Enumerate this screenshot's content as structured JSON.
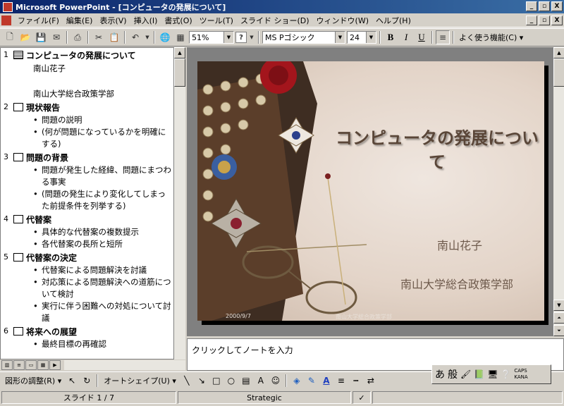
{
  "window": {
    "title": "Microsoft PowerPoint - [コンピュータの発展について]",
    "minimize": "_",
    "maximize": "▫",
    "close": "X"
  },
  "menu": [
    "ファイル(F)",
    "編集(E)",
    "表示(V)",
    "挿入(I)",
    "書式(O)",
    "ツール(T)",
    "スライド ショー(D)",
    "ウィンドウ(W)",
    "ヘルプ(H)"
  ],
  "toolbar": {
    "zoom": "51%",
    "font": "MS Pゴシック",
    "font_size": "24",
    "bold": "B",
    "italic": "I",
    "underline": "U",
    "common_tasks": "よく使う機能(C) ▾"
  },
  "outline": {
    "slides": [
      {
        "num": "1",
        "title": "コンピュータの発展について",
        "subs": [
          "南山花子",
          "",
          "南山大学総合政策学部"
        ],
        "bullets": []
      },
      {
        "num": "2",
        "title": "現状報告",
        "subs": [],
        "bullets": [
          "問題の説明",
          "(何が問題になっているかを明確にする)"
        ]
      },
      {
        "num": "3",
        "title": "問題の背景",
        "subs": [],
        "bullets": [
          "問題が発生した経緯、問題にまつわる事実",
          "(問題の発生により変化してしまった前提条件を列挙する)"
        ]
      },
      {
        "num": "4",
        "title": "代替案",
        "subs": [],
        "bullets": [
          "具体的な代替案の複数提示",
          "各代替案の長所と短所"
        ]
      },
      {
        "num": "5",
        "title": "代替案の決定",
        "subs": [],
        "bullets": [
          "代替案による問題解決を討議",
          "対応策による問題解決への道筋について検討",
          "実行に伴う困難への対処について討議"
        ]
      },
      {
        "num": "6",
        "title": "将来への展望",
        "subs": [],
        "bullets": [
          "最終目標の再確認"
        ]
      }
    ]
  },
  "slide": {
    "title": "コンピュータの発展について",
    "subtitle1": "南山花子",
    "subtitle2": "南山大学総合政策学部",
    "date": "2000/9/7",
    "footer": "南山大学総合政策学部"
  },
  "notes": {
    "placeholder": "クリックしてノートを入力"
  },
  "drawing": {
    "draw_menu": "図形の調整(R) ▾",
    "autoshapes": "オートシェイプ(U) ▾"
  },
  "ime": {
    "mode": "あ",
    "dictionary": "般",
    "caps": "CAPS",
    "kana": "KANA"
  },
  "status": {
    "slide_counter": "スライド 1 / 7",
    "design": "Strategic"
  }
}
